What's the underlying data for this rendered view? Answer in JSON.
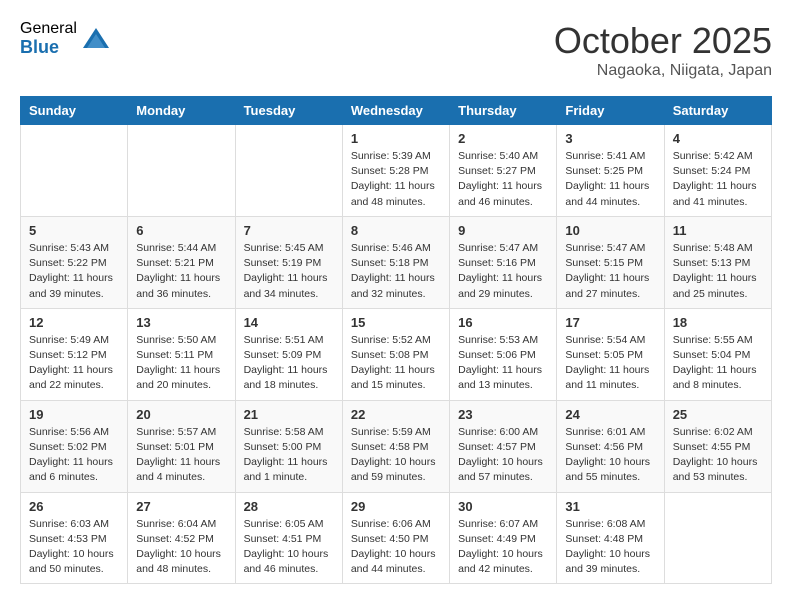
{
  "header": {
    "logo_general": "General",
    "logo_blue": "Blue",
    "month_title": "October 2025",
    "location": "Nagaoka, Niigata, Japan"
  },
  "weekdays": [
    "Sunday",
    "Monday",
    "Tuesday",
    "Wednesday",
    "Thursday",
    "Friday",
    "Saturday"
  ],
  "weeks": [
    [
      {
        "day": "",
        "info": ""
      },
      {
        "day": "",
        "info": ""
      },
      {
        "day": "",
        "info": ""
      },
      {
        "day": "1",
        "info": "Sunrise: 5:39 AM\nSunset: 5:28 PM\nDaylight: 11 hours\nand 48 minutes."
      },
      {
        "day": "2",
        "info": "Sunrise: 5:40 AM\nSunset: 5:27 PM\nDaylight: 11 hours\nand 46 minutes."
      },
      {
        "day": "3",
        "info": "Sunrise: 5:41 AM\nSunset: 5:25 PM\nDaylight: 11 hours\nand 44 minutes."
      },
      {
        "day": "4",
        "info": "Sunrise: 5:42 AM\nSunset: 5:24 PM\nDaylight: 11 hours\nand 41 minutes."
      }
    ],
    [
      {
        "day": "5",
        "info": "Sunrise: 5:43 AM\nSunset: 5:22 PM\nDaylight: 11 hours\nand 39 minutes."
      },
      {
        "day": "6",
        "info": "Sunrise: 5:44 AM\nSunset: 5:21 PM\nDaylight: 11 hours\nand 36 minutes."
      },
      {
        "day": "7",
        "info": "Sunrise: 5:45 AM\nSunset: 5:19 PM\nDaylight: 11 hours\nand 34 minutes."
      },
      {
        "day": "8",
        "info": "Sunrise: 5:46 AM\nSunset: 5:18 PM\nDaylight: 11 hours\nand 32 minutes."
      },
      {
        "day": "9",
        "info": "Sunrise: 5:47 AM\nSunset: 5:16 PM\nDaylight: 11 hours\nand 29 minutes."
      },
      {
        "day": "10",
        "info": "Sunrise: 5:47 AM\nSunset: 5:15 PM\nDaylight: 11 hours\nand 27 minutes."
      },
      {
        "day": "11",
        "info": "Sunrise: 5:48 AM\nSunset: 5:13 PM\nDaylight: 11 hours\nand 25 minutes."
      }
    ],
    [
      {
        "day": "12",
        "info": "Sunrise: 5:49 AM\nSunset: 5:12 PM\nDaylight: 11 hours\nand 22 minutes."
      },
      {
        "day": "13",
        "info": "Sunrise: 5:50 AM\nSunset: 5:11 PM\nDaylight: 11 hours\nand 20 minutes."
      },
      {
        "day": "14",
        "info": "Sunrise: 5:51 AM\nSunset: 5:09 PM\nDaylight: 11 hours\nand 18 minutes."
      },
      {
        "day": "15",
        "info": "Sunrise: 5:52 AM\nSunset: 5:08 PM\nDaylight: 11 hours\nand 15 minutes."
      },
      {
        "day": "16",
        "info": "Sunrise: 5:53 AM\nSunset: 5:06 PM\nDaylight: 11 hours\nand 13 minutes."
      },
      {
        "day": "17",
        "info": "Sunrise: 5:54 AM\nSunset: 5:05 PM\nDaylight: 11 hours\nand 11 minutes."
      },
      {
        "day": "18",
        "info": "Sunrise: 5:55 AM\nSunset: 5:04 PM\nDaylight: 11 hours\nand 8 minutes."
      }
    ],
    [
      {
        "day": "19",
        "info": "Sunrise: 5:56 AM\nSunset: 5:02 PM\nDaylight: 11 hours\nand 6 minutes."
      },
      {
        "day": "20",
        "info": "Sunrise: 5:57 AM\nSunset: 5:01 PM\nDaylight: 11 hours\nand 4 minutes."
      },
      {
        "day": "21",
        "info": "Sunrise: 5:58 AM\nSunset: 5:00 PM\nDaylight: 11 hours\nand 1 minute."
      },
      {
        "day": "22",
        "info": "Sunrise: 5:59 AM\nSunset: 4:58 PM\nDaylight: 10 hours\nand 59 minutes."
      },
      {
        "day": "23",
        "info": "Sunrise: 6:00 AM\nSunset: 4:57 PM\nDaylight: 10 hours\nand 57 minutes."
      },
      {
        "day": "24",
        "info": "Sunrise: 6:01 AM\nSunset: 4:56 PM\nDaylight: 10 hours\nand 55 minutes."
      },
      {
        "day": "25",
        "info": "Sunrise: 6:02 AM\nSunset: 4:55 PM\nDaylight: 10 hours\nand 53 minutes."
      }
    ],
    [
      {
        "day": "26",
        "info": "Sunrise: 6:03 AM\nSunset: 4:53 PM\nDaylight: 10 hours\nand 50 minutes."
      },
      {
        "day": "27",
        "info": "Sunrise: 6:04 AM\nSunset: 4:52 PM\nDaylight: 10 hours\nand 48 minutes."
      },
      {
        "day": "28",
        "info": "Sunrise: 6:05 AM\nSunset: 4:51 PM\nDaylight: 10 hours\nand 46 minutes."
      },
      {
        "day": "29",
        "info": "Sunrise: 6:06 AM\nSunset: 4:50 PM\nDaylight: 10 hours\nand 44 minutes."
      },
      {
        "day": "30",
        "info": "Sunrise: 6:07 AM\nSunset: 4:49 PM\nDaylight: 10 hours\nand 42 minutes."
      },
      {
        "day": "31",
        "info": "Sunrise: 6:08 AM\nSunset: 4:48 PM\nDaylight: 10 hours\nand 39 minutes."
      },
      {
        "day": "",
        "info": ""
      }
    ]
  ]
}
